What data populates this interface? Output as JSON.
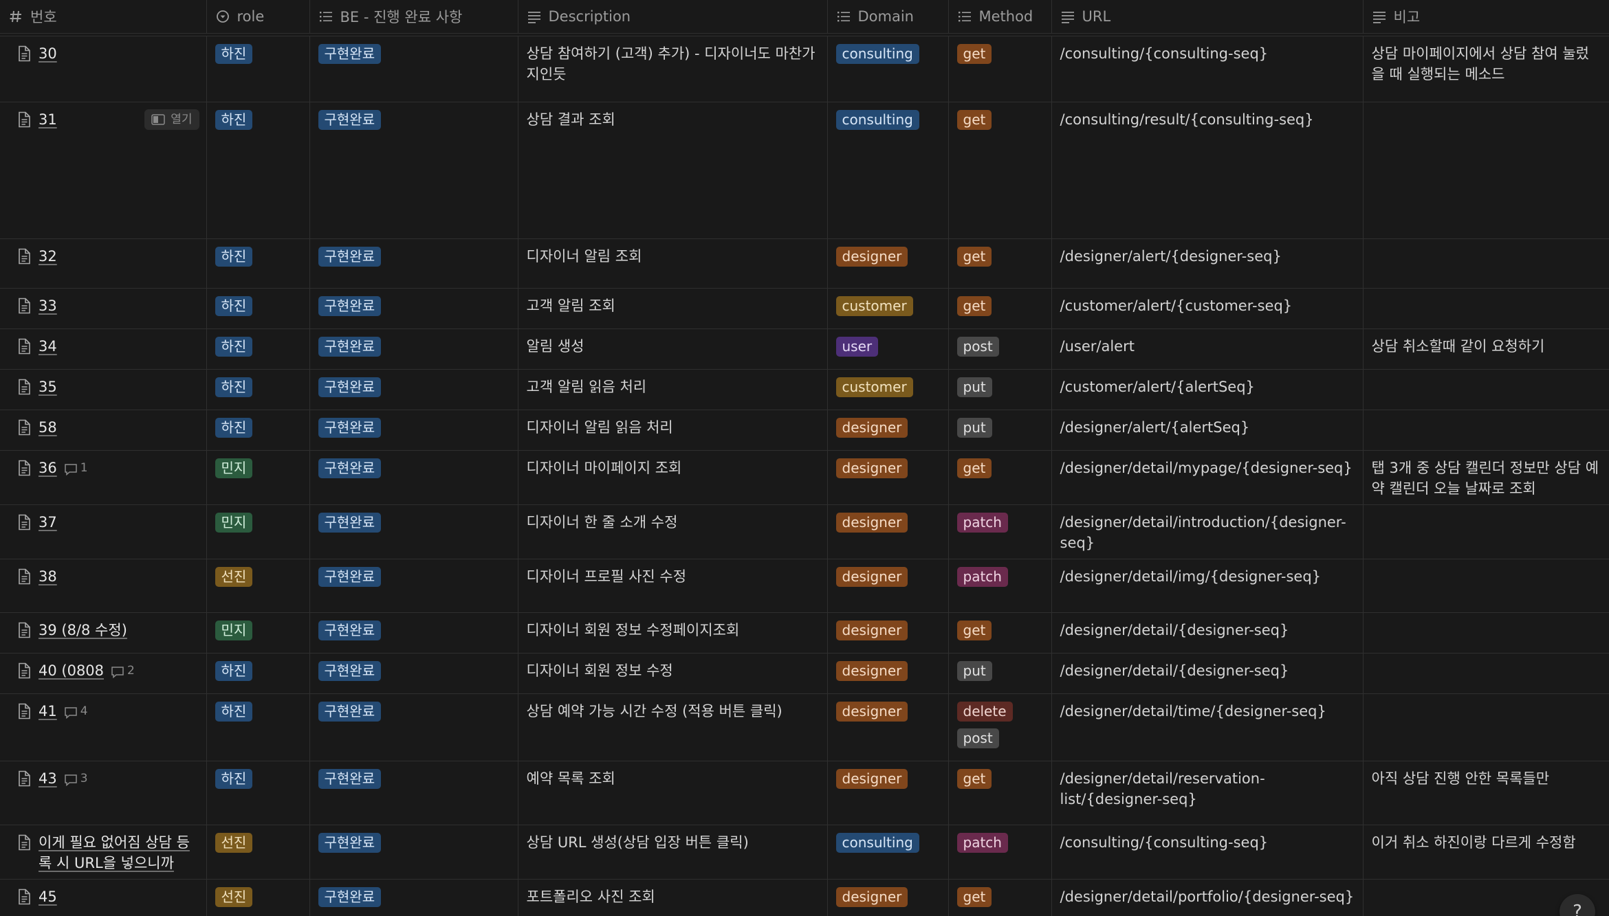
{
  "columns": [
    {
      "label": "번호",
      "icon": "hash-icon"
    },
    {
      "label": "role",
      "icon": "select-icon"
    },
    {
      "label": "BE - 진행 완료 사항",
      "icon": "list-icon"
    },
    {
      "label": "Description",
      "icon": "text-icon"
    },
    {
      "label": "Domain",
      "icon": "list-icon"
    },
    {
      "label": "Method",
      "icon": "list-icon"
    },
    {
      "label": "URL",
      "icon": "text-icon"
    },
    {
      "label": "비고",
      "icon": "text-icon"
    }
  ],
  "open_label": "열기",
  "help_label": "?",
  "rows": [
    {
      "num": "30",
      "comments": null,
      "role": "하진",
      "role_color": "blue",
      "status": "구현완료",
      "desc": "상담 참여하기 (고객)  추가) - 디자이너도 마찬가지인듯",
      "domain": "consulting",
      "domain_color": "blue",
      "methods": [
        {
          "label": "get",
          "color": "orange"
        }
      ],
      "url": "/consulting/{consulting-seq}",
      "note": "상담 마이페이지에서 상담 참여 눌렀을 때 실행되는 메소드",
      "h": 77
    },
    {
      "num": "31",
      "comments": null,
      "open": true,
      "role": "하진",
      "role_color": "blue",
      "status": "구현완료",
      "desc": "상담 결과 조회",
      "domain": "consulting",
      "domain_color": "blue",
      "methods": [
        {
          "label": "get",
          "color": "orange"
        }
      ],
      "url": "/consulting/result/{consulting-seq}",
      "note": "",
      "h": 180
    },
    {
      "num": "32",
      "comments": null,
      "role": "하진",
      "role_color": "blue",
      "status": "구현완료",
      "desc": "디자이너 알림 조회",
      "domain": "designer",
      "domain_color": "orange",
      "methods": [
        {
          "label": "get",
          "color": "orange"
        }
      ],
      "url": "/designer/alert/{designer-seq}",
      "note": "",
      "h": 53
    },
    {
      "num": "33",
      "comments": null,
      "role": "하진",
      "role_color": "blue",
      "status": "구현완료",
      "desc": "고객 알림 조회",
      "domain": "customer",
      "domain_color": "gold",
      "methods": [
        {
          "label": "get",
          "color": "orange"
        }
      ],
      "url": "/customer/alert/{customer-seq}",
      "note": "",
      "h": 33
    },
    {
      "num": "34",
      "comments": null,
      "role": "하진",
      "role_color": "blue",
      "status": "구현완료",
      "desc": "알림 생성",
      "domain": "user",
      "domain_color": "purple",
      "methods": [
        {
          "label": "post",
          "color": "gray"
        }
      ],
      "url": "/user/alert",
      "note": "상담 취소할때 같이 요청하기",
      "h": 33
    },
    {
      "num": "35",
      "comments": null,
      "role": "하진",
      "role_color": "blue",
      "status": "구현완료",
      "desc": "고객 알림 읽음 처리",
      "domain": "customer",
      "domain_color": "gold",
      "methods": [
        {
          "label": "put",
          "color": "gray"
        }
      ],
      "url": "/customer/alert/{alertSeq}",
      "note": "",
      "h": 33
    },
    {
      "num": "58",
      "comments": null,
      "role": "하진",
      "role_color": "blue",
      "status": "구현완료",
      "desc": "디자이너 알림 읽음 처리",
      "domain": "designer",
      "domain_color": "orange",
      "methods": [
        {
          "label": "put",
          "color": "gray"
        }
      ],
      "url": "/designer/alert/{alertSeq}",
      "note": "",
      "h": 33
    },
    {
      "num": "36",
      "comments": "1",
      "role": "민지",
      "role_color": "green",
      "status": "구현완료",
      "desc": "디자이너 마이페이지 조회",
      "domain": "designer",
      "domain_color": "orange",
      "methods": [
        {
          "label": "get",
          "color": "orange"
        }
      ],
      "url": "/designer/detail/mypage/{designer-seq}",
      "note": "탭 3개 중 상담 캘린더 정보만 상담 예약 캘린더 오늘 날짜로 조회",
      "h": 53
    },
    {
      "num": "37",
      "comments": null,
      "role": "민지",
      "role_color": "green",
      "status": "구현완료",
      "desc": "디자이너 한 줄 소개 수정",
      "domain": "designer",
      "domain_color": "orange",
      "methods": [
        {
          "label": "patch",
          "color": "magenta"
        }
      ],
      "url": "/designer/detail/introduction/{designer-seq}",
      "note": "",
      "h": 33
    },
    {
      "num": "38",
      "comments": null,
      "role": "선진",
      "role_color": "gold",
      "status": "구현완료",
      "desc": "디자이너 프로필 사진 수정",
      "domain": "designer",
      "domain_color": "orange",
      "methods": [
        {
          "label": "patch",
          "color": "magenta"
        }
      ],
      "url": "/designer/detail/img/{designer-seq}",
      "note": "",
      "h": 59
    },
    {
      "num": "39 (8/8 수정)",
      "comments": null,
      "role": "민지",
      "role_color": "green",
      "status": "구현완료",
      "desc": "디자이너 회원 정보 수정페이지조회",
      "domain": "designer",
      "domain_color": "orange",
      "methods": [
        {
          "label": "get",
          "color": "orange"
        }
      ],
      "url": "/designer/detail/{designer-seq}",
      "note": "",
      "h": 33
    },
    {
      "num": "40 (0808",
      "comments": "2",
      "role": "하진",
      "role_color": "blue",
      "status": "구현완료",
      "desc": "디자이너 회원 정보 수정",
      "domain": "designer",
      "domain_color": "orange",
      "methods": [
        {
          "label": "put",
          "color": "gray"
        }
      ],
      "url": "/designer/detail/{designer-seq}",
      "note": "",
      "h": 33
    },
    {
      "num": "41",
      "comments": "4",
      "role": "하진",
      "role_color": "blue",
      "status": "구현완료",
      "desc": "상담 예약 가능 시간 수정 (적용 버튼 클릭)",
      "domain": "designer",
      "domain_color": "orange",
      "methods": [
        {
          "label": "delete",
          "color": "red"
        },
        {
          "label": "post",
          "color": "gray"
        }
      ],
      "url": "/designer/detail/time/{designer-seq}",
      "note": "",
      "h": 59
    },
    {
      "num": "43",
      "comments": "3",
      "role": "하진",
      "role_color": "blue",
      "status": "구현완료",
      "desc": "예약 목록 조회",
      "domain": "designer",
      "domain_color": "orange",
      "methods": [
        {
          "label": "get",
          "color": "orange"
        }
      ],
      "url": "/designer/detail/reservation-list/{designer-seq}",
      "note": "아직 상담 진행 안한 목록들만",
      "h": 74
    },
    {
      "num": "이게 필요 없어짐 상담 등록 시 URL을 넣으니까",
      "comments": null,
      "role": "선진",
      "role_color": "gold",
      "status": "구현완료",
      "desc": "상담 URL 생성(상담 입장 버튼 클릭)",
      "domain": "consulting",
      "domain_color": "blue",
      "methods": [
        {
          "label": "patch",
          "color": "magenta"
        }
      ],
      "url": "/consulting/{consulting-seq}",
      "note": "이거 취소 하진이랑 다르게 수정함",
      "h": 53
    },
    {
      "num": "45",
      "comments": null,
      "role": "선진",
      "role_color": "gold",
      "status": "구현완료",
      "desc": "포트폴리오 사진 조회",
      "domain": "designer",
      "domain_color": "orange",
      "methods": [
        {
          "label": "get",
          "color": "orange"
        }
      ],
      "url": "/designer/detail/portfolio/{designer-seq}",
      "note": "",
      "h": 40
    }
  ]
}
